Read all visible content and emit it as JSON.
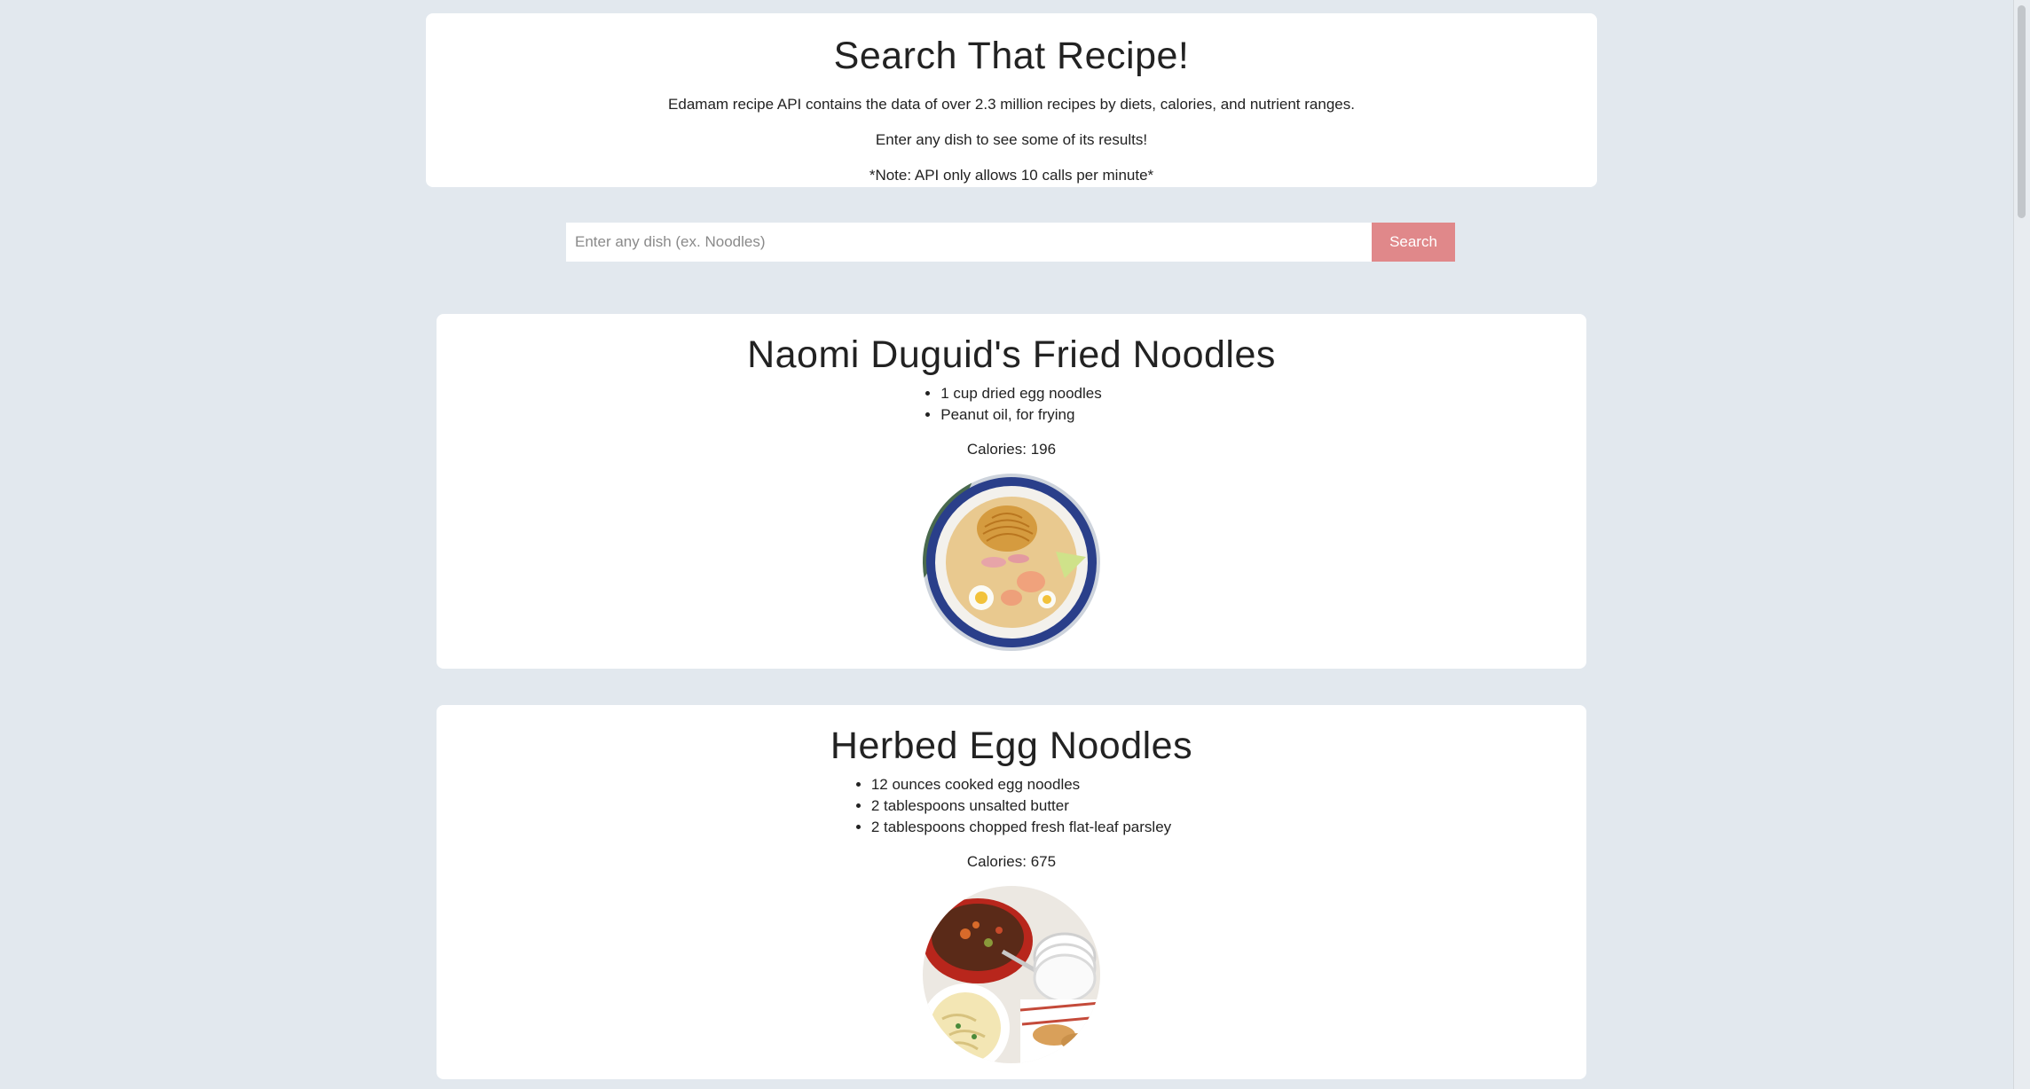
{
  "header": {
    "title": "Search That Recipe!",
    "description": "Edamam recipe API contains the data of over 2.3 million recipes by diets, calories, and nutrient ranges.",
    "hint": "Enter any dish to see some of its results!",
    "note": "*Note: API only allows 10 calls per minute*"
  },
  "search": {
    "placeholder": "Enter any dish (ex. Noodles)",
    "value": "",
    "button_label": "Search"
  },
  "recipes": [
    {
      "title": "Naomi Duguid's Fried Noodles",
      "ingredients": [
        "1 cup dried egg noodles",
        "Peanut oil, for frying"
      ],
      "calories": "Calories: 196",
      "image_icon": "noodle-soup-bowl-image"
    },
    {
      "title": "Herbed Egg Noodles",
      "ingredients": [
        "12 ounces cooked egg noodles",
        "2 tablespoons unsalted butter",
        "2 tablespoons chopped fresh flat-leaf parsley"
      ],
      "calories": "Calories: 675",
      "image_icon": "stew-and-noodles-image"
    }
  ],
  "colors": {
    "background": "#e2e8ee",
    "card": "#ffffff",
    "search_button": "#e0888a"
  }
}
